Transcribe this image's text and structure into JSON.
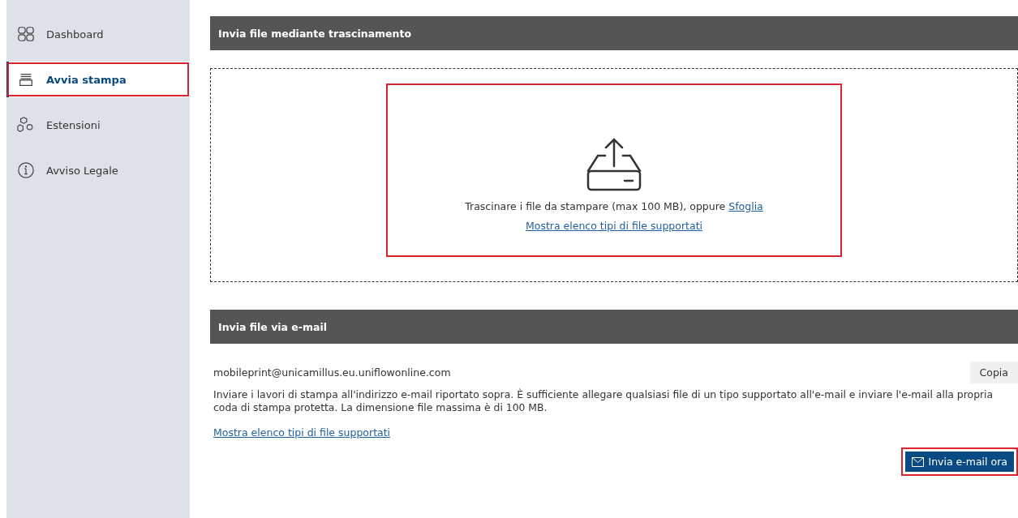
{
  "sidebar": {
    "items": [
      {
        "label": "Dashboard",
        "selected": false,
        "highlighted": false
      },
      {
        "label": "Avvia stampa",
        "selected": true,
        "highlighted": true
      },
      {
        "label": "Estensioni",
        "selected": false,
        "highlighted": false
      },
      {
        "label": "Avviso Legale",
        "selected": false,
        "highlighted": false
      }
    ]
  },
  "upload": {
    "title": "Invia file mediante trascinamento",
    "highlighted": true,
    "prompt": "Trascinare i file da stampare (max 100 MB), oppure",
    "browse_link": "Sfoglia",
    "types_link": "Mostra elenco tipi di file supportati"
  },
  "email": {
    "title": "Invia file via e-mail",
    "address": "mobileprint@unicamillus.eu.uniflowonline.com",
    "copy_button": "Copia",
    "description": "Inviare i lavori di stampa all'indirizzo e-mail riportato sopra. È sufficiente allegare qualsiasi file di un tipo supportato all'e-mail e inviare l'e-mail alla propria coda di stampa protetta. La dimensione file massima è di 100 MB.",
    "types_link": "Mostra elenco tipi di file supportati",
    "send_button": "Invia e-mail ora",
    "send_highlighted": true
  }
}
